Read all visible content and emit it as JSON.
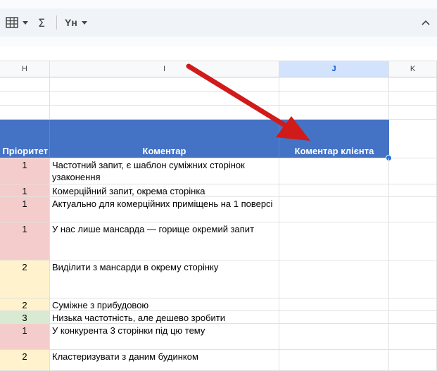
{
  "toolbar": {
    "sigma_label": "Σ",
    "yh_label": "Yн",
    "icons": [
      "table-format-icon",
      "chevron-down-icon",
      "sigma-icon",
      "format-icon",
      "chevron-up-icon"
    ]
  },
  "columns": [
    {
      "letter": "H",
      "selected": false
    },
    {
      "letter": "I",
      "selected": false
    },
    {
      "letter": "J",
      "selected": true
    },
    {
      "letter": "K",
      "selected": false
    }
  ],
  "header_row": {
    "priority": "Пріоритет",
    "comment": "Коментар",
    "client_comment": "Коментар клієнта"
  },
  "rows": [
    {
      "priority": "1",
      "color": "red",
      "comment": "Частотний запит, є шаблон суміжних сторінок узаконення"
    },
    {
      "priority": "1",
      "color": "red",
      "comment": "Комерційний запит, окрема сторінка"
    },
    {
      "priority": "1",
      "color": "red",
      "comment": "Актуально для комерційних приміщень на 1 поверсі"
    },
    {
      "priority": "1",
      "color": "red",
      "comment": "У нас лише мансарда — горище окремий запит"
    },
    {
      "priority": "2",
      "color": "yellow",
      "comment": "Виділити з мансарди в окрему сторінку"
    },
    {
      "priority": "2",
      "color": "yellow",
      "comment": "Суміжне з прибудовою"
    },
    {
      "priority": "3",
      "color": "green",
      "comment": "Низька частотність, але дешево зробити"
    },
    {
      "priority": "1",
      "color": "red",
      "comment": "У конкурента 3 сторінки під цю тему"
    },
    {
      "priority": "2",
      "color": "yellow",
      "comment": "Кластеризувати з даним будинком"
    }
  ],
  "colors": {
    "header_blue": "#4472c4",
    "selected_col": "#d3e3fd",
    "arrow_red": "#d11a1a",
    "priority_red": "#f4cccc",
    "priority_yellow": "#fff2cc",
    "priority_green": "#d9ead3"
  }
}
